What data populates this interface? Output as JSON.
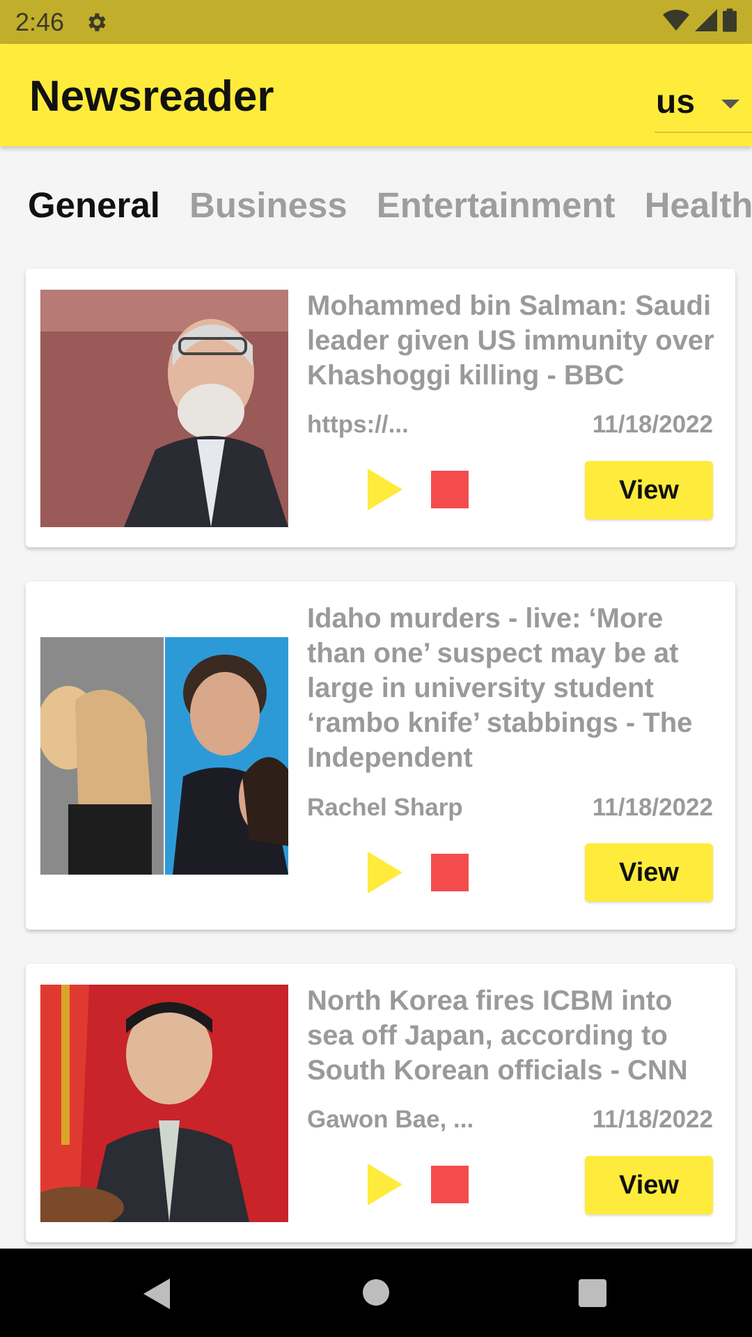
{
  "status_bar": {
    "time": "2:46",
    "icons": [
      "gear-icon",
      "wifi-icon",
      "signal-icon",
      "battery-icon"
    ]
  },
  "app_bar": {
    "title": "Newsreader",
    "country": "us",
    "background": "#ffeb3b"
  },
  "tabs": [
    {
      "label": "General",
      "active": true
    },
    {
      "label": "Business",
      "active": false
    },
    {
      "label": "Entertainment",
      "active": false
    },
    {
      "label": "Health",
      "active": false
    }
  ],
  "articles": [
    {
      "headline": "Mohammed bin Salman: Saudi leader given US immunity over Khashoggi killing - BBC",
      "source": "https://...",
      "date": "11/18/2022",
      "view_label": "View",
      "image": "person-at-podium-photo"
    },
    {
      "headline": "Idaho murders - live: ‘More than one’ suspect may be at large in university student ‘rambo knife’ stabbings - The Independent",
      "source": "Rachel Sharp",
      "date": "11/18/2022",
      "view_label": "View",
      "image": "group-photo"
    },
    {
      "headline": "North Korea fires ICBM into sea off Japan, according to South Korean officials - CNN",
      "source": "Gawon Bae, ...",
      "date": "11/18/2022",
      "view_label": "View",
      "image": "speaker-red-flag-photo"
    }
  ],
  "colors": {
    "accent": "#ffeb3b",
    "status_bar": "#c1ae2a",
    "stop": "#f44c4c",
    "muted_text": "#9a9a9a"
  }
}
